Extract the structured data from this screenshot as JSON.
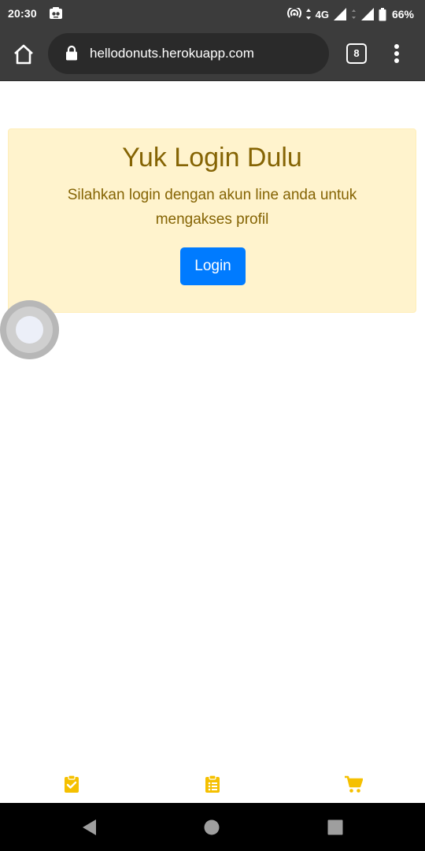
{
  "status_bar": {
    "time": "20:30",
    "network": "4G",
    "battery": "66%",
    "icons": [
      "notification-app-icon",
      "hotspot-icon",
      "data-arrows-icon",
      "signal-icon",
      "battery-icon"
    ]
  },
  "browser": {
    "url": "hellodonuts.herokuapp.com",
    "tab_count": "8",
    "icons": [
      "home-icon",
      "lock-icon",
      "more-vert-icon"
    ]
  },
  "alert": {
    "heading": "Yuk Login Dulu",
    "message": "Silahkan login dengan akun line anda untuk mengakses profil",
    "button_label": "Login"
  },
  "bottom_nav": {
    "items": [
      "clipboard-check-icon",
      "clipboard-list-icon",
      "shopping-cart-icon"
    ]
  },
  "system_nav": {
    "buttons": [
      "back-icon",
      "home-circle-icon",
      "recents-icon"
    ]
  },
  "colors": {
    "status_bar": "#3c3c3c",
    "url_bar": "#2a2a2a",
    "alert_background": "#fff3cd",
    "alert_border": "#ffeeba",
    "alert_text": "#856404",
    "button_primary": "#007bff",
    "nav_icon": "#f5c000",
    "system_nav_background": "#000000"
  }
}
